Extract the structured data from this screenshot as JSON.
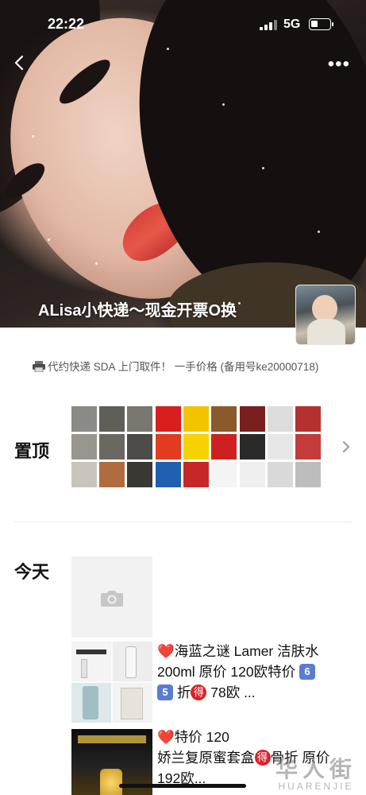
{
  "status_bar": {
    "time": "22:22",
    "network": "5G"
  },
  "profile": {
    "nickname": "ALisa小快递～现金开票O换",
    "signature": "代约快递 SDA 上门取件！ 一手价格 (备用号ke20000718)"
  },
  "pinned": {
    "label": "置顶",
    "tiles": [
      {
        "name": "sea-cucumber-photo",
        "colors": [
          "#8a8a86",
          "#5f5e59",
          "#7a7670",
          "#9a968f",
          "#6b6862",
          "#4d4b47",
          "#c9c5bd",
          "#b06c3f",
          "#3a3835"
        ]
      },
      {
        "name": "courier-logos-photo",
        "colors": [
          "#d81e1e",
          "#f2c400",
          "#8a5a2b",
          "#e23b1f",
          "#f6d200",
          "#cf2020",
          "#1f5fb0",
          "#c62828",
          "#f4f4f4"
        ]
      },
      {
        "name": "gift-boxes-photo",
        "colors": [
          "#7a1f1f",
          "#dcdcdc",
          "#b5312f",
          "#2a2a2a",
          "#e6e6e6",
          "#c33b3b",
          "#efefef",
          "#d9d9d9",
          "#bdbdbd"
        ]
      }
    ]
  },
  "today": {
    "label": "今天",
    "posts": [
      {
        "lines": [
          "海蓝之谜 Lamer 洁肤水",
          "200ml 原价 120欧特价 ",
          " 折",
          " 78欧 ..."
        ],
        "chip_a": "6",
        "chip_b": "5",
        "deal_mark": "得"
      },
      {
        "lines": [
          "特价 120",
          "娇兰复原蜜套盒",
          "骨折 原价",
          "192欧..."
        ],
        "deal_mark": "得"
      }
    ]
  },
  "watermark": {
    "main": "华人街",
    "sub": "HUARENJIE"
  }
}
